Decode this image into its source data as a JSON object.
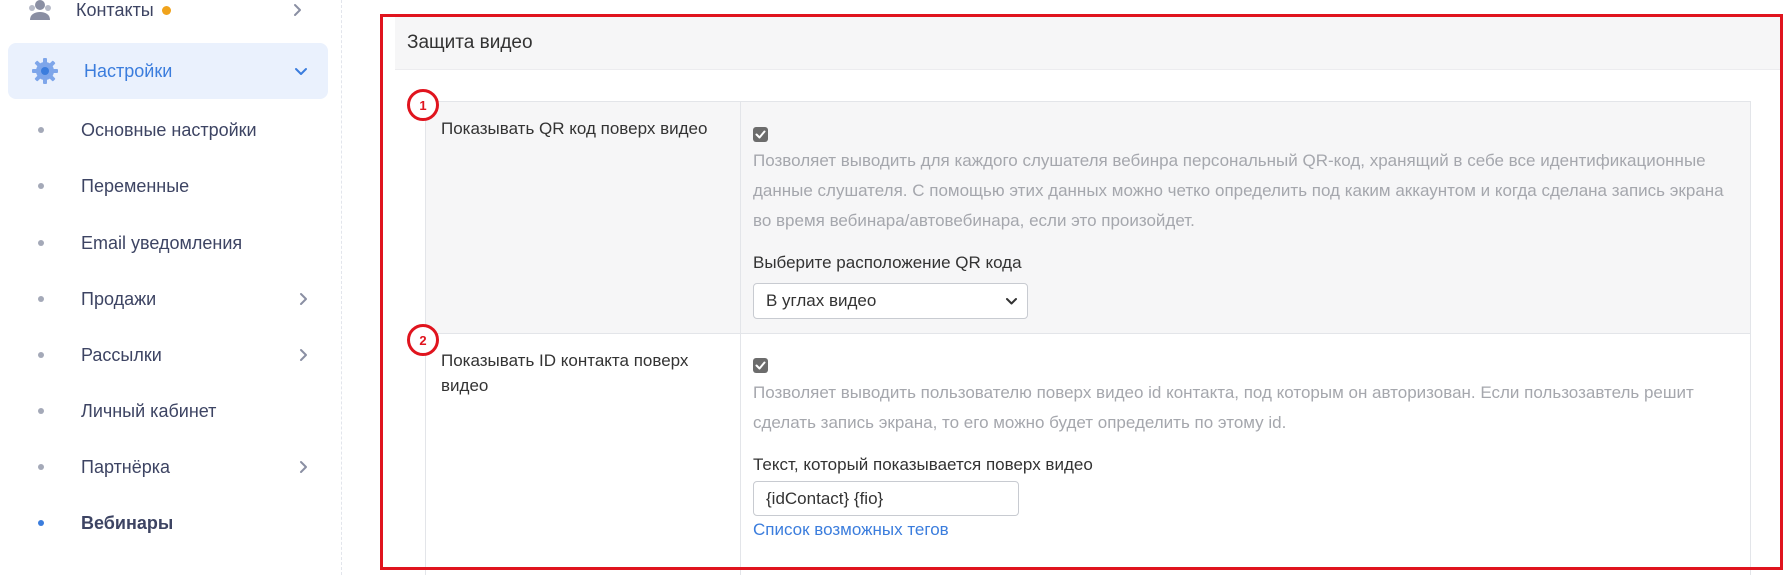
{
  "sidebar": {
    "contacts_label": "Контакты",
    "contacts_icon": "contacts-icon",
    "settings_label": "Настройки",
    "settings_icon": "gear-icon",
    "items": [
      {
        "label": "Основные настройки",
        "has_chevron": false,
        "active": false
      },
      {
        "label": "Переменные",
        "has_chevron": false,
        "active": false
      },
      {
        "label": "Email уведомления",
        "has_chevron": false,
        "active": false
      },
      {
        "label": "Продажи",
        "has_chevron": true,
        "active": false
      },
      {
        "label": "Рассылки",
        "has_chevron": true,
        "active": false
      },
      {
        "label": "Личный кабинет",
        "has_chevron": false,
        "active": false
      },
      {
        "label": "Партнёрка",
        "has_chevron": true,
        "active": false
      },
      {
        "label": "Вебинары",
        "has_chevron": false,
        "active": true
      }
    ]
  },
  "main": {
    "header_title": "Защита видео",
    "annotation_color": "#e0141e",
    "sections": [
      {
        "badge": "1",
        "label": "Показывать QR код поверх видео",
        "checked": true,
        "description": "Позволяет выводить для каждого слушателя вебинра персональный QR-код, хранящий в себе все идентификационные данные слушателя. С помощью этих данных можно четко определить под каким аккаунтом и когда сделана запись экрана во время вебинара/автовебинара, если это произойдет.",
        "field_label": "Выберите расположение QR кода",
        "select_value": "В углах видео"
      },
      {
        "badge": "2",
        "label": "Показывать ID контакта поверх видео",
        "checked": true,
        "description": "Позволяет выводить пользователю поверх видео id контакта, под которым он авторизован. Если пользозавтель решит сделать запись экрана, то его можно будет определить по этому id.",
        "field_label": "Текст, который показывается поверх видео",
        "input_value": "{idContact} {fio}",
        "link_label": "Список возможных тегов"
      }
    ]
  },
  "colors": {
    "accent": "#3b7ddd",
    "active_bg": "#eaf1fd",
    "contacts_dot": "#f0a31c"
  }
}
